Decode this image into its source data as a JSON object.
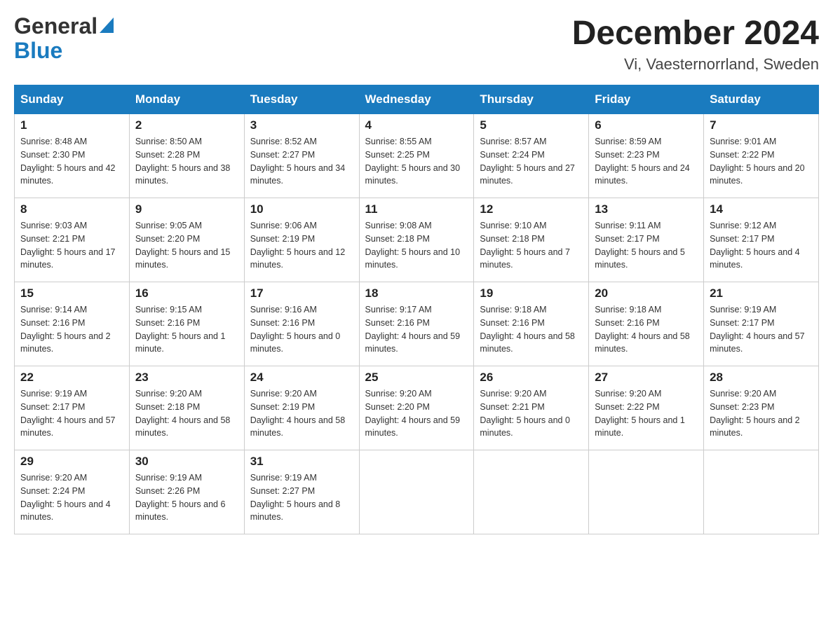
{
  "header": {
    "month_year": "December 2024",
    "location": "Vi, Vaesternorrland, Sweden",
    "logo_line1": "General",
    "logo_line2": "Blue"
  },
  "weekdays": [
    "Sunday",
    "Monday",
    "Tuesday",
    "Wednesday",
    "Thursday",
    "Friday",
    "Saturday"
  ],
  "weeks": [
    [
      {
        "day": "1",
        "sunrise": "8:48 AM",
        "sunset": "2:30 PM",
        "daylight": "5 hours and 42 minutes."
      },
      {
        "day": "2",
        "sunrise": "8:50 AM",
        "sunset": "2:28 PM",
        "daylight": "5 hours and 38 minutes."
      },
      {
        "day": "3",
        "sunrise": "8:52 AM",
        "sunset": "2:27 PM",
        "daylight": "5 hours and 34 minutes."
      },
      {
        "day": "4",
        "sunrise": "8:55 AM",
        "sunset": "2:25 PM",
        "daylight": "5 hours and 30 minutes."
      },
      {
        "day": "5",
        "sunrise": "8:57 AM",
        "sunset": "2:24 PM",
        "daylight": "5 hours and 27 minutes."
      },
      {
        "day": "6",
        "sunrise": "8:59 AM",
        "sunset": "2:23 PM",
        "daylight": "5 hours and 24 minutes."
      },
      {
        "day": "7",
        "sunrise": "9:01 AM",
        "sunset": "2:22 PM",
        "daylight": "5 hours and 20 minutes."
      }
    ],
    [
      {
        "day": "8",
        "sunrise": "9:03 AM",
        "sunset": "2:21 PM",
        "daylight": "5 hours and 17 minutes."
      },
      {
        "day": "9",
        "sunrise": "9:05 AM",
        "sunset": "2:20 PM",
        "daylight": "5 hours and 15 minutes."
      },
      {
        "day": "10",
        "sunrise": "9:06 AM",
        "sunset": "2:19 PM",
        "daylight": "5 hours and 12 minutes."
      },
      {
        "day": "11",
        "sunrise": "9:08 AM",
        "sunset": "2:18 PM",
        "daylight": "5 hours and 10 minutes."
      },
      {
        "day": "12",
        "sunrise": "9:10 AM",
        "sunset": "2:18 PM",
        "daylight": "5 hours and 7 minutes."
      },
      {
        "day": "13",
        "sunrise": "9:11 AM",
        "sunset": "2:17 PM",
        "daylight": "5 hours and 5 minutes."
      },
      {
        "day": "14",
        "sunrise": "9:12 AM",
        "sunset": "2:17 PM",
        "daylight": "5 hours and 4 minutes."
      }
    ],
    [
      {
        "day": "15",
        "sunrise": "9:14 AM",
        "sunset": "2:16 PM",
        "daylight": "5 hours and 2 minutes."
      },
      {
        "day": "16",
        "sunrise": "9:15 AM",
        "sunset": "2:16 PM",
        "daylight": "5 hours and 1 minute."
      },
      {
        "day": "17",
        "sunrise": "9:16 AM",
        "sunset": "2:16 PM",
        "daylight": "5 hours and 0 minutes."
      },
      {
        "day": "18",
        "sunrise": "9:17 AM",
        "sunset": "2:16 PM",
        "daylight": "4 hours and 59 minutes."
      },
      {
        "day": "19",
        "sunrise": "9:18 AM",
        "sunset": "2:16 PM",
        "daylight": "4 hours and 58 minutes."
      },
      {
        "day": "20",
        "sunrise": "9:18 AM",
        "sunset": "2:16 PM",
        "daylight": "4 hours and 58 minutes."
      },
      {
        "day": "21",
        "sunrise": "9:19 AM",
        "sunset": "2:17 PM",
        "daylight": "4 hours and 57 minutes."
      }
    ],
    [
      {
        "day": "22",
        "sunrise": "9:19 AM",
        "sunset": "2:17 PM",
        "daylight": "4 hours and 57 minutes."
      },
      {
        "day": "23",
        "sunrise": "9:20 AM",
        "sunset": "2:18 PM",
        "daylight": "4 hours and 58 minutes."
      },
      {
        "day": "24",
        "sunrise": "9:20 AM",
        "sunset": "2:19 PM",
        "daylight": "4 hours and 58 minutes."
      },
      {
        "day": "25",
        "sunrise": "9:20 AM",
        "sunset": "2:20 PM",
        "daylight": "4 hours and 59 minutes."
      },
      {
        "day": "26",
        "sunrise": "9:20 AM",
        "sunset": "2:21 PM",
        "daylight": "5 hours and 0 minutes."
      },
      {
        "day": "27",
        "sunrise": "9:20 AM",
        "sunset": "2:22 PM",
        "daylight": "5 hours and 1 minute."
      },
      {
        "day": "28",
        "sunrise": "9:20 AM",
        "sunset": "2:23 PM",
        "daylight": "5 hours and 2 minutes."
      }
    ],
    [
      {
        "day": "29",
        "sunrise": "9:20 AM",
        "sunset": "2:24 PM",
        "daylight": "5 hours and 4 minutes."
      },
      {
        "day": "30",
        "sunrise": "9:19 AM",
        "sunset": "2:26 PM",
        "daylight": "5 hours and 6 minutes."
      },
      {
        "day": "31",
        "sunrise": "9:19 AM",
        "sunset": "2:27 PM",
        "daylight": "5 hours and 8 minutes."
      },
      null,
      null,
      null,
      null
    ]
  ]
}
